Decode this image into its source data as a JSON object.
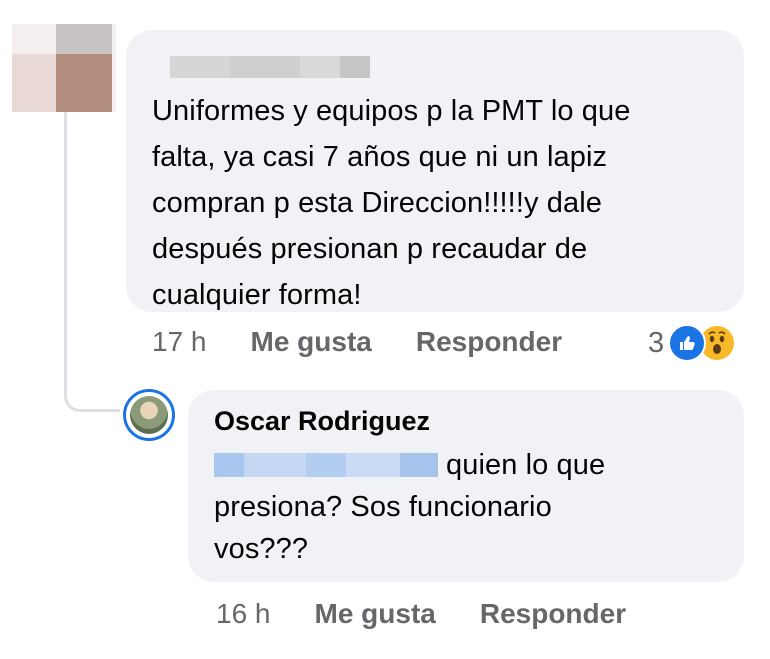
{
  "comment": {
    "text": "Uniformes y equipos p la PMT lo que falta, ya casi 7 años que ni un lapiz compran p esta Direccion!!!!!y dale después presionan p recaudar de cualquier forma!",
    "lines": [
      "Uniformes y equipos p la PMT lo que",
      "falta, ya casi 7 años que ni un lapiz",
      "compran p esta Direccion!!!!!y dale",
      "después presionan p recaudar de",
      "cualquier forma!"
    ],
    "time": "17 h",
    "like_label": "Me gusta",
    "reply_label": "Responder",
    "reaction_count": "3",
    "reactions": [
      "like-icon",
      "wow-icon"
    ]
  },
  "reply": {
    "author": "Oscar Rodriguez",
    "text_after_mention": "quien lo que",
    "lines": [
      "presiona? Sos funcionario",
      "vos???"
    ],
    "time": "16 h",
    "like_label": "Me gusta",
    "reply_label": "Responder"
  },
  "colors": {
    "bubble": "#f0f2f5",
    "secondary_text": "#65676b",
    "like_blue": "#1b74e4",
    "wow_yellow": "#f7b928"
  }
}
